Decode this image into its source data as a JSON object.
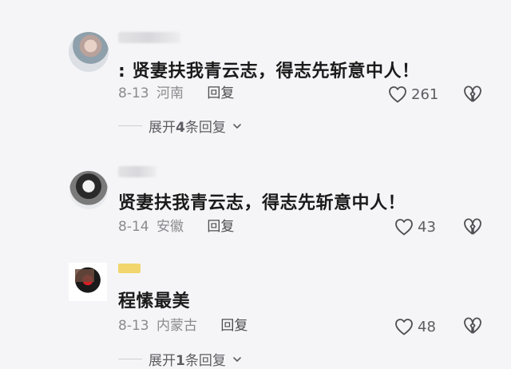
{
  "comments": [
    {
      "text": ": 贤妻扶我青云志，得志先斩意中人！",
      "date": "8-13",
      "location": "河南",
      "reply": "回复",
      "likes": "261"
    },
    {
      "text": "贤妻扶我青云志，得志先斩意中人！",
      "date": "8-14",
      "location": "安徽",
      "reply": "回复",
      "likes": "43"
    },
    {
      "text": "程愫最美",
      "date": "8-13",
      "location": "内蒙古",
      "reply": "回复",
      "likes": "48"
    }
  ],
  "expand": [
    {
      "prefix": "展开",
      "count": "4",
      "suffix": "条回复"
    },
    {
      "prefix": "展开",
      "count": "1",
      "suffix": "条回复"
    }
  ],
  "icons": {
    "like": "heart-outline-icon",
    "dislike": "broken-heart-icon",
    "expand": "chevron-down-icon"
  },
  "colors": {
    "background": "#f5f5f7",
    "text": "#1b1b1b",
    "muted": "#8a8a8f",
    "accent_badge": "#f1d66d"
  }
}
